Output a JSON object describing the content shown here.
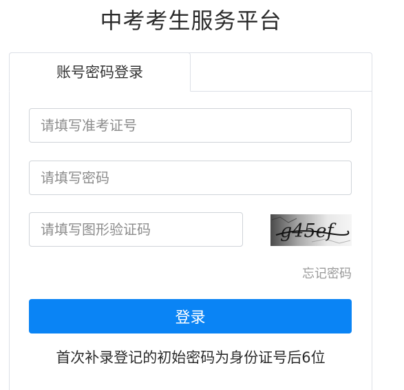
{
  "header": {
    "title": "中考考生服务平台"
  },
  "tabs": [
    {
      "label": "账号密码登录",
      "active": true
    }
  ],
  "form": {
    "exam_id": {
      "placeholder": "请填写准考证号",
      "value": ""
    },
    "password": {
      "placeholder": "请填写密码",
      "value": ""
    },
    "captcha": {
      "placeholder": "请填写图形验证码",
      "value": ""
    },
    "captcha_image_text": "g45ef",
    "forgot_password_label": "忘记密码",
    "login_button_label": "登录"
  },
  "notice": "首次补录登记的初始密码为身份证号后6位",
  "colors": {
    "primary": "#0a84f5",
    "border": "#dcdfe6",
    "muted": "#999999"
  }
}
